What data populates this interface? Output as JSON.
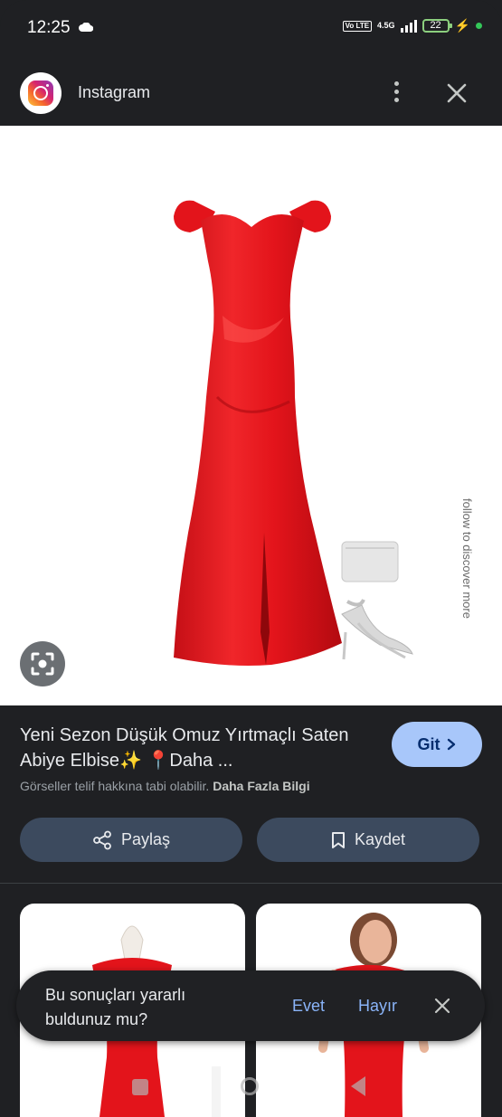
{
  "status_bar": {
    "time": "12:25",
    "volte": "Vo LTE",
    "network": "4.5G",
    "battery": "22"
  },
  "app_bar": {
    "title": "Instagram"
  },
  "result": {
    "title": "Yeni Sezon Düşük Omuz Yırtmaçlı Saten Abiye Elbise✨ 📍Daha ...",
    "visit_label": "Git",
    "notice_text": "Görseller telif hakkına tabi olabilir.",
    "notice_link": "Daha Fazla Bilgi",
    "share_label": "Paylaş",
    "save_label": "Kaydet"
  },
  "image": {
    "side_text": "follow to discover more"
  },
  "snackbar": {
    "question": "Bu sonuçları yararlı buldunuz mu?",
    "yes_label": "Evet",
    "no_label": "Hayır"
  },
  "colors": {
    "background": "#1f2023",
    "accent": "#a8c7fa",
    "button_bg": "#3c4a5e",
    "dress_red": "#e3141b"
  }
}
